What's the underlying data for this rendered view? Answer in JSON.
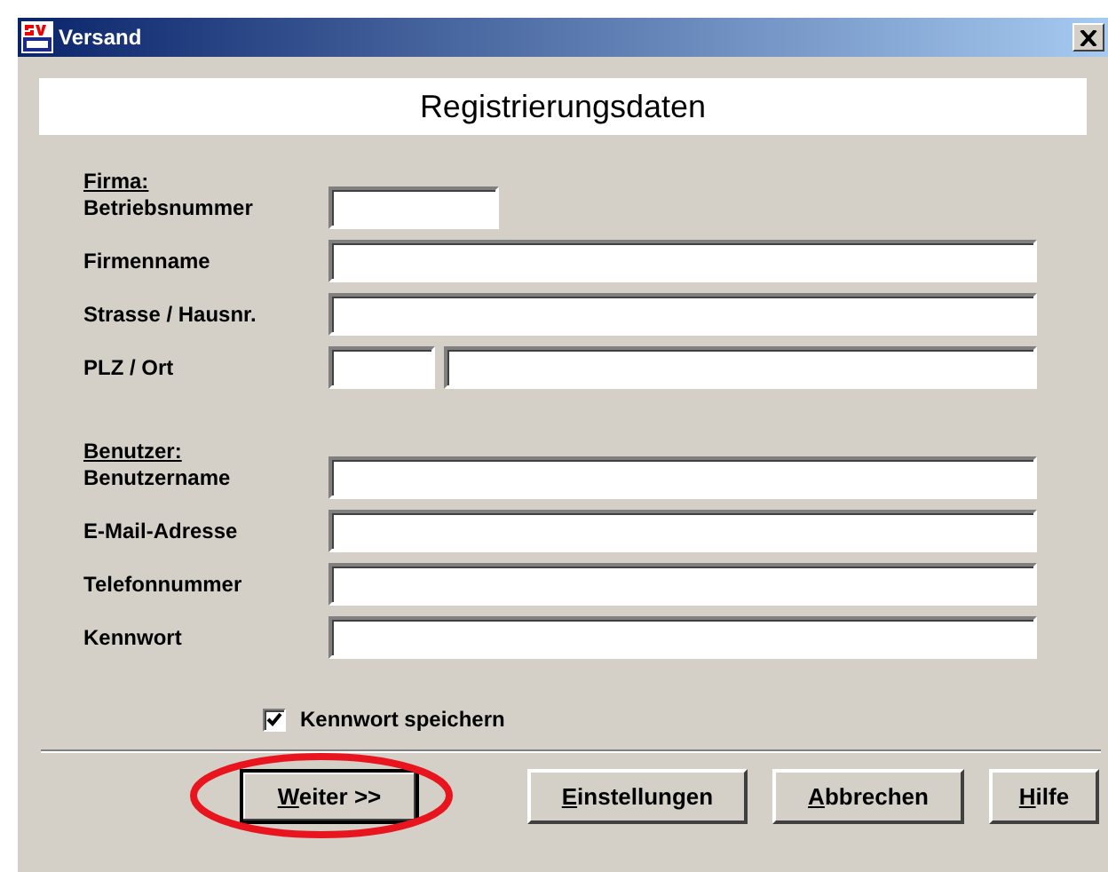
{
  "window": {
    "title": "Versand"
  },
  "header": "Registrierungsdaten",
  "sections": [
    {
      "heading": "Firma:",
      "fields": [
        {
          "label": "Betriebsnummer",
          "inputs": [
            {
              "kind": "short"
            }
          ]
        },
        {
          "label": "Firmenname",
          "inputs": [
            {
              "kind": "full"
            }
          ]
        },
        {
          "label": "Strasse / Hausnr.",
          "inputs": [
            {
              "kind": "full"
            }
          ]
        },
        {
          "label": "PLZ / Ort",
          "inputs": [
            {
              "kind": "zip"
            },
            {
              "kind": "city"
            }
          ]
        }
      ]
    },
    {
      "heading": "Benutzer:",
      "fields": [
        {
          "label": "Benutzername",
          "inputs": [
            {
              "kind": "full"
            }
          ]
        },
        {
          "label": "E-Mail-Adresse",
          "inputs": [
            {
              "kind": "full"
            }
          ]
        },
        {
          "label": "Telefonnummer",
          "inputs": [
            {
              "kind": "full"
            }
          ]
        },
        {
          "label": "Kennwort",
          "inputs": [
            {
              "kind": "full"
            }
          ]
        }
      ]
    }
  ],
  "save_password": {
    "label": "Kennwort speichern",
    "checked": true
  },
  "buttons": [
    {
      "label": "Weiter >>",
      "mnemonic": true,
      "circled": true
    },
    {
      "label": "Einstellungen",
      "mnemonic": true,
      "circled": false
    },
    {
      "label": "Abbrechen",
      "mnemonic": true,
      "circled": false
    },
    {
      "label": "Hilfe",
      "mnemonic": true,
      "circled": false
    }
  ]
}
